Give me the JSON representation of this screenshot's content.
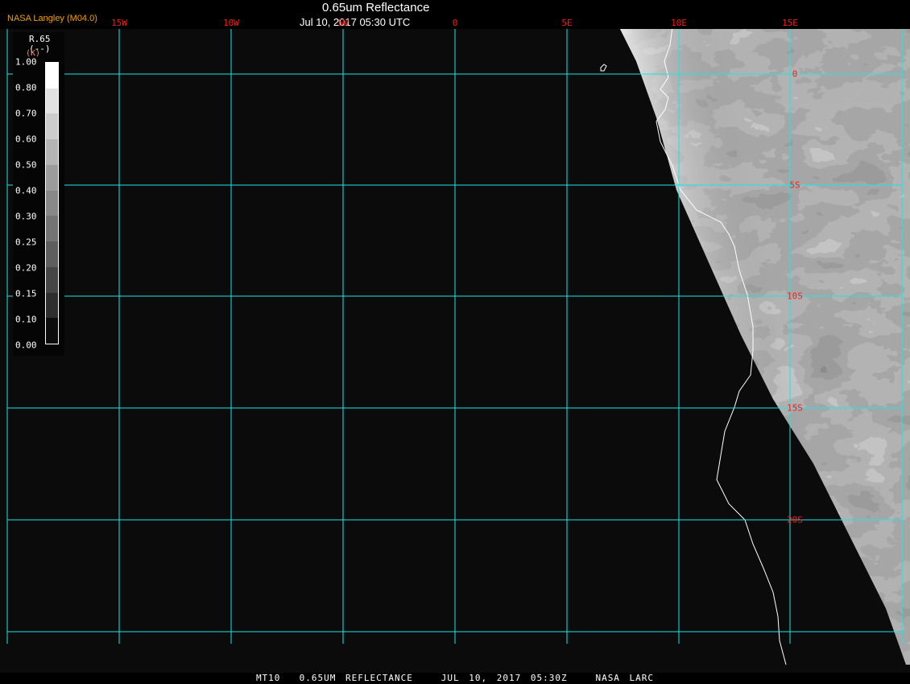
{
  "header": {
    "title": "0.65um Reflectance",
    "datetime": "Jul 10, 2017 05:30 UTC",
    "logo": "NASA Langley (M04.0)"
  },
  "grid": {
    "color": "#19e6e6",
    "lon_labels": [
      "15W",
      "10W",
      "5W",
      "0",
      "5E",
      "10E",
      "15E"
    ],
    "lat_labels": [
      "0",
      "5S",
      "10S",
      "15S",
      "20S"
    ],
    "label_color": "#ff1a1a"
  },
  "legend": {
    "param": "R.65",
    "units": "(--)",
    "units_alt": "(K)",
    "labels": [
      "1.00",
      "0.80",
      "0.70",
      "0.60",
      "0.50",
      "0.40",
      "0.30",
      "0.25",
      "0.20",
      "0.15",
      "0.10",
      "0.00"
    ],
    "colors": [
      "#ffffff",
      "#e2e2e2",
      "#cccccc",
      "#b4b4b4",
      "#9c9c9c",
      "#888888",
      "#747474",
      "#5e5e5e",
      "#464646",
      "#2e2e2e",
      "#0c0c0c"
    ]
  },
  "footer": {
    "text": "MT10  0.65UM REFLECTANCE   JUL 10, 2017 05:30Z   NASA LARC"
  }
}
